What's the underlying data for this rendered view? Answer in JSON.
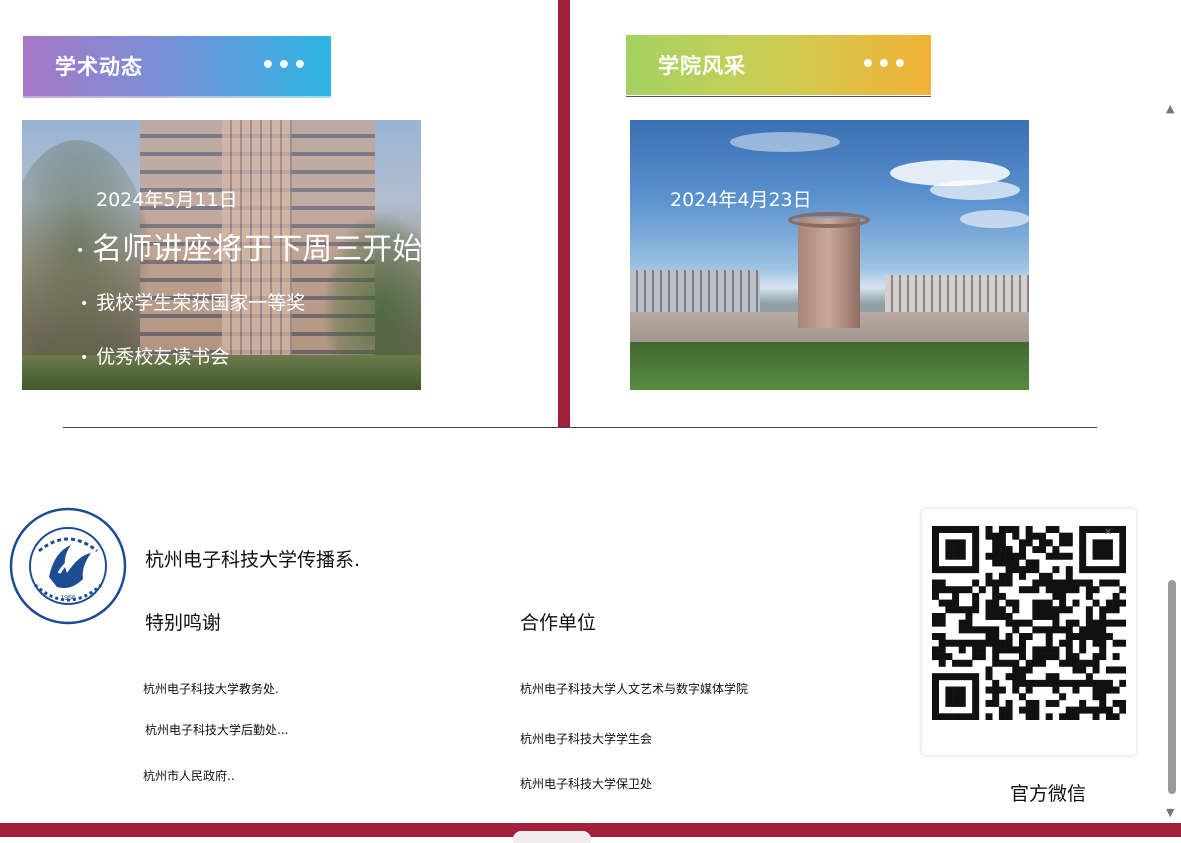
{
  "academic": {
    "title": "学术动态",
    "more": "•••",
    "date": "2024年5月11日",
    "headline": "名师讲座将于下周三开始",
    "items": [
      "我校学生荣获国家一等奖",
      "优秀校友读书会"
    ],
    "bullet": "•"
  },
  "college": {
    "title": "学院风采",
    "more": "•••",
    "date": "2024年4月23日"
  },
  "footer": {
    "university": "杭州电子科技大学传播系.",
    "logo_year": "1956",
    "thanks": {
      "title": "特别鸣谢",
      "items": [
        "杭州电子科技大学教务处.",
        "杭州电子科技大学后勤处...",
        "杭州市人民政府.."
      ]
    },
    "partners": {
      "title": "合作单位",
      "items": [
        "杭州电子科技大学人文艺术与数字媒体学院",
        "杭州电子科技大学学生会",
        "杭州电子科技大学保卫处"
      ]
    },
    "qr_label": "官方微信",
    "qr_close": "✕"
  },
  "colors": {
    "accent": "#a3203a",
    "academic_gradient": [
      "#a678c6",
      "#2db6e3"
    ],
    "college_gradient": [
      "#a4d262",
      "#f1b236"
    ]
  },
  "icons": {
    "more": "more-dots-icon",
    "scroll_up": "scroll-up-arrow-icon",
    "scroll_down": "scroll-down-arrow-icon",
    "close": "close-icon"
  }
}
